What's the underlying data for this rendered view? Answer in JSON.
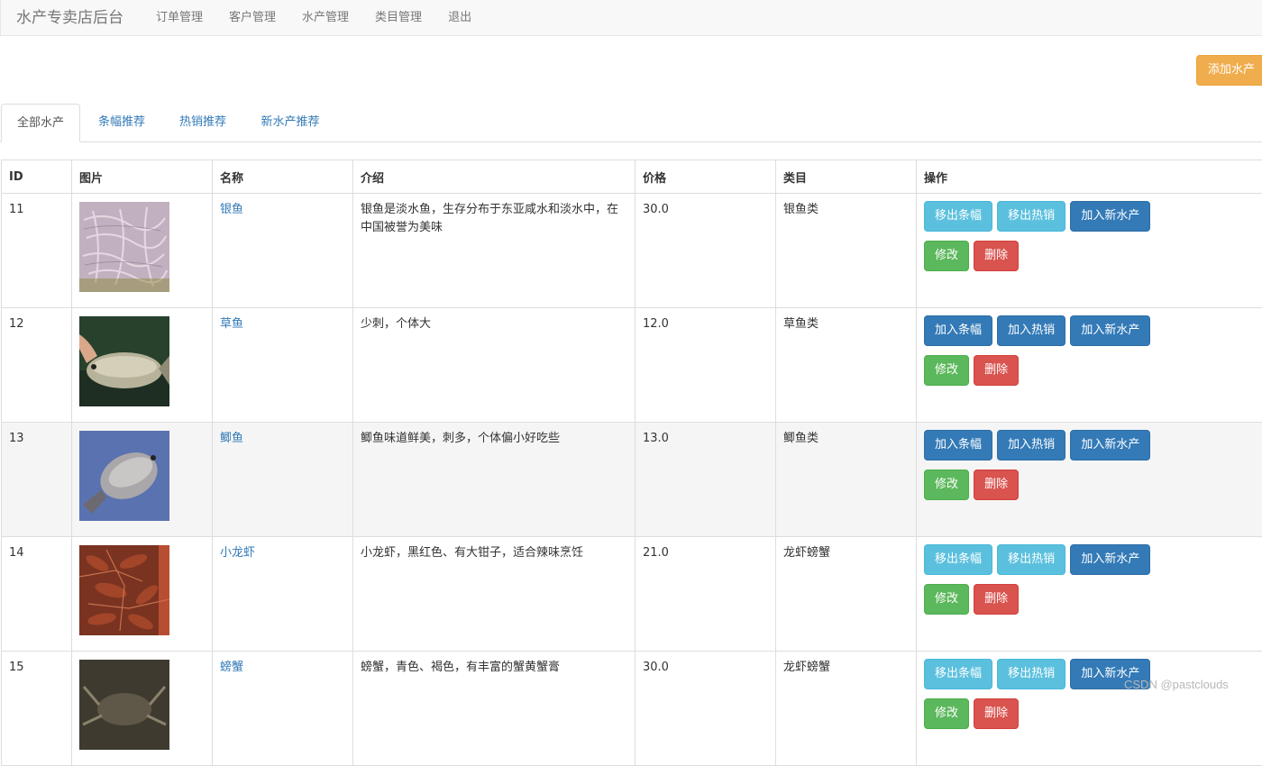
{
  "nav": {
    "brand": "水产专卖店后台",
    "links": [
      "订单管理",
      "客户管理",
      "水产管理",
      "类目管理",
      "退出"
    ]
  },
  "add_button": "添加水产",
  "tabs": [
    "全部水产",
    "条幅推荐",
    "热销推荐",
    "新水产推荐"
  ],
  "table": {
    "headers": [
      "ID",
      "图片",
      "名称",
      "介绍",
      "价格",
      "类目",
      "操作"
    ],
    "rows": [
      {
        "id": "11",
        "name": "银鱼",
        "intro": "银鱼是淡水鱼，生存分布于东亚咸水和淡水中，在中国被誉为美味",
        "price": "30.0",
        "category": "银鱼类",
        "banner_btn": "移出条幅",
        "hot_btn": "移出热销",
        "new_btn": "加入新水产",
        "edit_btn": "修改",
        "delete_btn": "删除"
      },
      {
        "id": "12",
        "name": "草鱼",
        "intro": "少刺，个体大",
        "price": "12.0",
        "category": "草鱼类",
        "banner_btn": "加入条幅",
        "hot_btn": "加入热销",
        "new_btn": "加入新水产",
        "edit_btn": "修改",
        "delete_btn": "删除"
      },
      {
        "id": "13",
        "name": "鲫鱼",
        "intro": "鲫鱼味道鲜美，刺多，个体偏小好吃些",
        "price": "13.0",
        "category": "鲫鱼类",
        "banner_btn": "加入条幅",
        "hot_btn": "加入热销",
        "new_btn": "加入新水产",
        "edit_btn": "修改",
        "delete_btn": "删除"
      },
      {
        "id": "14",
        "name": "小龙虾",
        "intro": "小龙虾，黑红色、有大钳子，适合辣味烹饪",
        "price": "21.0",
        "category": "龙虾螃蟹",
        "banner_btn": "移出条幅",
        "hot_btn": "移出热销",
        "new_btn": "加入新水产",
        "edit_btn": "修改",
        "delete_btn": "删除"
      },
      {
        "id": "15",
        "name": "螃蟹",
        "intro": "螃蟹，青色、褐色，有丰富的蟹黄蟹膏",
        "price": "30.0",
        "category": "龙虾螃蟹",
        "banner_btn": "移出条幅",
        "hot_btn": "移出热销",
        "new_btn": "加入新水产",
        "edit_btn": "修改",
        "delete_btn": "删除"
      }
    ]
  },
  "watermark": "CSDN @pastclouds",
  "colors": {
    "info": "#5bc0de",
    "primary": "#337ab7",
    "success": "#5cb85c",
    "danger": "#d9534f",
    "warning": "#f0ad4e"
  }
}
